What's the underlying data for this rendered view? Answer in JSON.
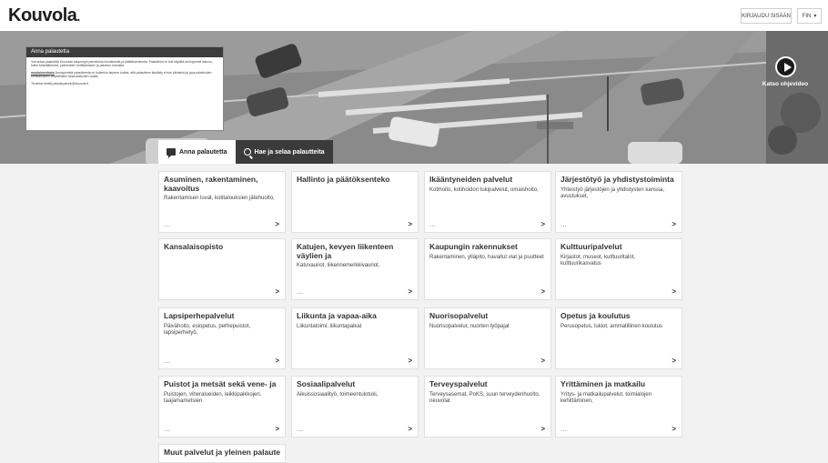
{
  "header": {
    "logo": "Kouvola",
    "login_label": "KIRJAUDU SISÄÄN",
    "language": "FIN"
  },
  "info_box": {
    "title": "Anna palautetta",
    "paragraphs": [
      "Voit antaa palautetta Kouvolan kaupungin palveluista lomakkeella ja päätöksenteosta. Palautteesi ei tule käyttää anonyymisti laisuus, tullen keskittämisesi, palveluiden kehittämiseen ja palvelun kannalta.",
      "Anonyymistä palautteesta on kuitenkin tarpeen todeta, että palautteen käsittely ei tule julkiseksi ja jopa palveluiden kehittämiseen tarpeellisten keskusteluiden osalta.",
      "Terveisin teidät palautepalvelu@kouvola.fi"
    ],
    "link": "muutoksenhaku"
  },
  "video": {
    "label": "Katso ohjevideo"
  },
  "tabs": [
    {
      "label": "Anna palautetta"
    },
    {
      "label": "Hae ja selaa palautteita"
    }
  ],
  "cards": [
    {
      "title": "Asuminen, rakentaminen, kaavoitus",
      "desc": "Rakentamisen luvat, kotitalouksien jätehuolto,",
      "more": "...",
      "chev": ">"
    },
    {
      "title": "Hallinto ja päätöksenteko",
      "desc": "",
      "more": "",
      "chev": ">"
    },
    {
      "title": "Ikääntyneiden palvelut",
      "desc": "Kotihoito, kotihoidon tukipalvelut, omaishoito,",
      "more": "...",
      "chev": ">"
    },
    {
      "title": "Järjestötyö ja yhdistystoiminta",
      "desc": "Yhteistyö järjestöjen ja yhdistysten kanssa, avustukset,",
      "more": "...",
      "chev": ">"
    },
    {
      "title": "Kansalaisopisto",
      "desc": "",
      "more": "",
      "chev": ">"
    },
    {
      "title": "Katujen, kevyen liikenteen väylien ja",
      "desc": "Katuvauriot, liikennemerkkivauriot,",
      "more": "...",
      "chev": ">"
    },
    {
      "title": "Kaupungin rakennukset",
      "desc": "Rakentaminen, ylläpito, havaitut viat ja puutteet",
      "more": "",
      "chev": ">"
    },
    {
      "title": "Kulttuuripalvelut",
      "desc": "Kirjastot, museot, kulttuuritalot, kulttuurikasvatus",
      "more": "",
      "chev": ">"
    },
    {
      "title": "Lapsiperhepalvelut",
      "desc": "Päivähoito, esiopetus, perhepuistot, lapsiperhetyö,",
      "more": "...",
      "chev": ">"
    },
    {
      "title": "Liikunta ja vapaa-aika",
      "desc": "Liikuntatoimi, liikuntapaikat",
      "more": "",
      "chev": ">"
    },
    {
      "title": "Nuorisopalvelut",
      "desc": "Nuorisopalvelut, nuorten työpajat",
      "more": "",
      "chev": ">"
    },
    {
      "title": "Opetus ja koulutus",
      "desc": "Perusopetus, lukiot, ammatillinen koulutus",
      "more": "",
      "chev": ">"
    },
    {
      "title": "Puistot ja metsät sekä vene- ja",
      "desc": "Puistojen, viheralueiden, leikkipaikkojen, taajamametsien",
      "more": "...",
      "chev": ">"
    },
    {
      "title": "Sosiaalipalvelut",
      "desc": "Aikuissosiaalityö, toimeentulotuki,",
      "more": "...",
      "chev": ">"
    },
    {
      "title": "Terveyspalvelut",
      "desc": "Terveysasemat, PoKS, suun terveydenhuolto, neuvolat",
      "more": "",
      "chev": ">"
    },
    {
      "title": "Yrittäminen ja matkailu",
      "desc": "Yritys- ja matkailupalvelut, toimialojen kehittäminen,",
      "more": "...",
      "chev": ">"
    },
    {
      "title": "Muut palvelut ja yleinen palaute",
      "desc": "",
      "more": "",
      "chev": ""
    }
  ]
}
